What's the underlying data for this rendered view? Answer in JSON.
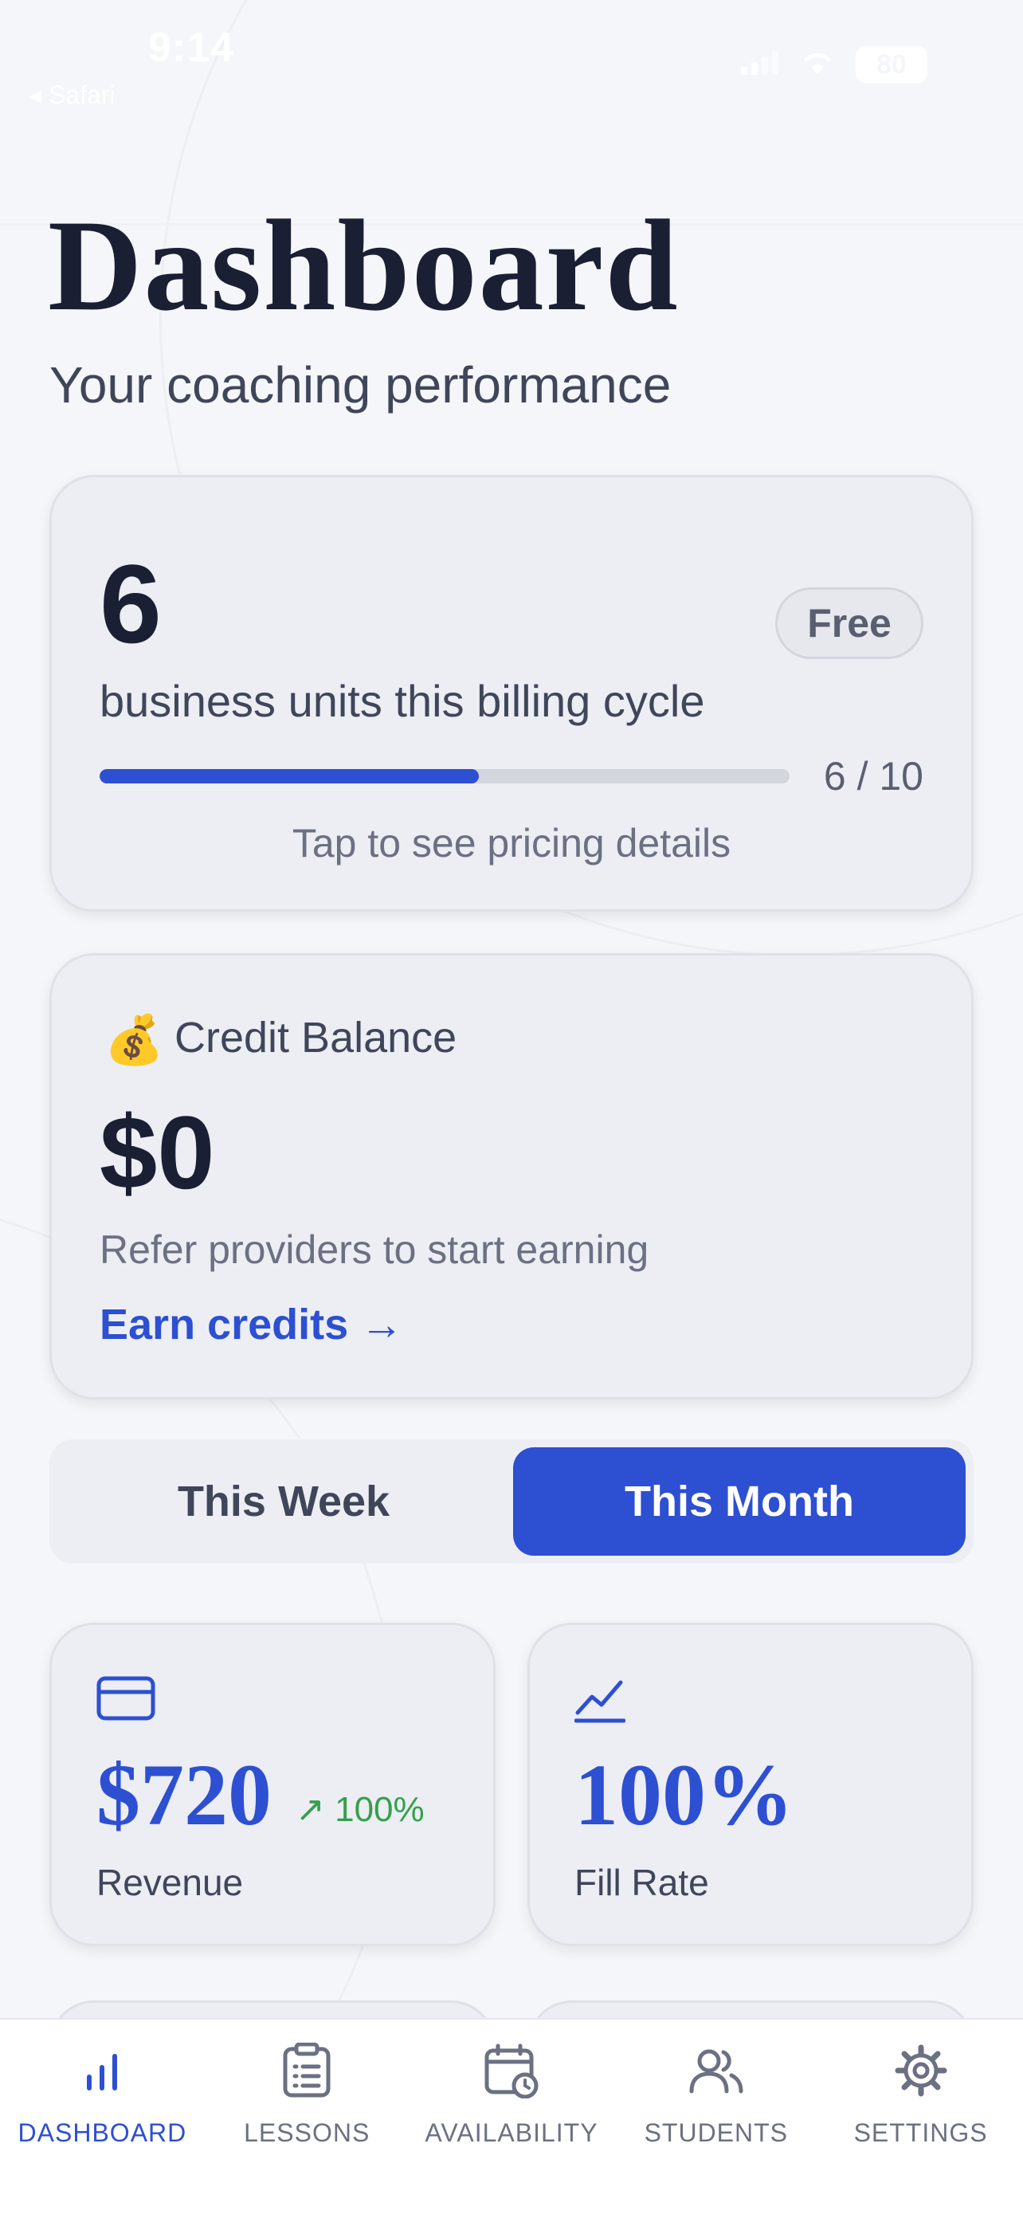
{
  "status_bar": {
    "time": "9:14",
    "back_app": "◂ Safari",
    "battery": "80"
  },
  "header": {
    "title": "Dashboard",
    "subtitle": "Your coaching performance"
  },
  "usage_card": {
    "count": "6",
    "plan_badge": "Free",
    "label": "business units this billing cycle",
    "progress_text": "6 / 10",
    "progress_fraction": 0.55,
    "pricing_link": "Tap to see pricing details"
  },
  "credit_card": {
    "icon": "💰",
    "title": "Credit Balance",
    "amount": "$0",
    "description": "Refer providers to start earning",
    "earn_link": "Earn credits →"
  },
  "period_toggle": {
    "week_label": "This Week",
    "month_label": "This Month",
    "selected": "This Month"
  },
  "stats": {
    "revenue": {
      "icon": "credit-card-icon",
      "value": "$720",
      "change": "↗ 100%",
      "label": "Revenue"
    },
    "fill_rate": {
      "icon": "trend-chart-icon",
      "value": "100%",
      "label": "Fill Rate"
    }
  },
  "tab_bar": {
    "items": [
      {
        "label": "DASHBOARD",
        "icon": "bar-chart-icon",
        "active": true
      },
      {
        "label": "LESSONS",
        "icon": "clipboard-list-icon",
        "active": false
      },
      {
        "label": "AVAILABILITY",
        "icon": "calendar-clock-icon",
        "active": false
      },
      {
        "label": "STUDENTS",
        "icon": "users-icon",
        "active": false
      },
      {
        "label": "SETTINGS",
        "icon": "gear-icon",
        "active": false
      }
    ]
  },
  "colors": {
    "accent": "#2d4fd2",
    "positive": "#35a04a",
    "text_primary": "#1b1f33",
    "text_secondary": "#40465a",
    "background": "#f5f6f9",
    "card": "#eceef4"
  }
}
